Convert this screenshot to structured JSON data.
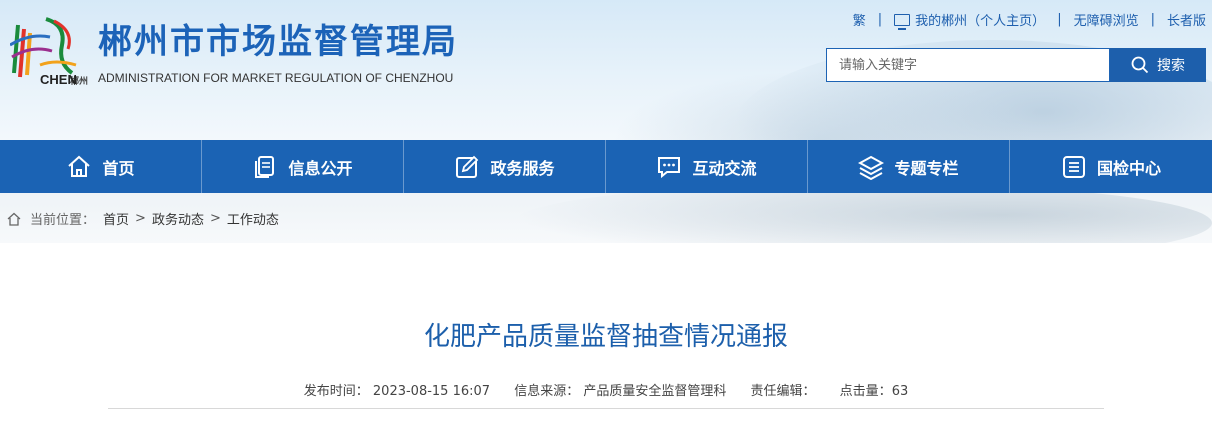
{
  "site": {
    "title": "郴州市市场监督管理局",
    "subtitle": "ADMINISTRATION FOR MARKET REGULATION OF CHENZHOU",
    "logo_cn": "郴州",
    "logo_en": "CHEN"
  },
  "toplinks": {
    "traditional": "繁",
    "my_chenzhou": "我的郴州（个人主页）",
    "accessible": "无障碍浏览",
    "elder": "长者版"
  },
  "search": {
    "placeholder": "请输入关键字",
    "button": "搜索"
  },
  "nav": {
    "items": [
      {
        "label": "首页",
        "icon": "home-icon"
      },
      {
        "label": "信息公开",
        "icon": "document-icon"
      },
      {
        "label": "政务服务",
        "icon": "edit-icon"
      },
      {
        "label": "互动交流",
        "icon": "chat-icon"
      },
      {
        "label": "专题专栏",
        "icon": "layers-icon"
      },
      {
        "label": "国检中心",
        "icon": "list-icon"
      }
    ]
  },
  "breadcrumb": {
    "prefix": "当前位置：",
    "items": [
      "首页",
      "政务动态",
      "工作动态"
    ]
  },
  "article": {
    "title": "化肥产品质量监督抽查情况通报",
    "publish_time_label": "发布时间：",
    "publish_time": "2023-08-15 16:07",
    "source_label": "信息来源：",
    "source": "产品质量安全监督管理科",
    "editor_label": "责任编辑：",
    "editor": "",
    "views_label": "点击量：",
    "views": "63"
  },
  "colors": {
    "primary": "#1b63b4",
    "title_blue": "#1c63b8"
  }
}
